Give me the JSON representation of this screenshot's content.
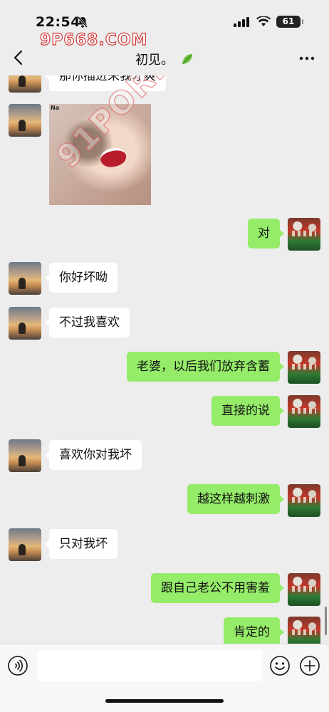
{
  "status_bar": {
    "time": "22:54",
    "battery": "61",
    "icons": [
      "bell-slash-icon",
      "signal-icon",
      "wifi-icon",
      "battery-icon"
    ]
  },
  "watermarks": {
    "top": "9P668.COM",
    "diagonal": "91PORN.COM"
  },
  "header": {
    "title": "初见。",
    "title_icon": "leaf-emoji",
    "back_icon": "chevron-left-icon",
    "more_icon": "more-dots-icon"
  },
  "sticker": {
    "tag": "Na"
  },
  "messages": [
    {
      "side": "left",
      "text": "那你插进来我才爽"
    },
    {
      "side": "left",
      "type": "sticker"
    },
    {
      "side": "right",
      "text": "对"
    },
    {
      "side": "left",
      "text": "你好坏呦"
    },
    {
      "side": "left",
      "text": "不过我喜欢"
    },
    {
      "side": "right",
      "text": "老婆，以后我们放弃含蓄"
    },
    {
      "side": "right",
      "text": "直接的说"
    },
    {
      "side": "left",
      "text": "喜欢你对我坏"
    },
    {
      "side": "right",
      "text": "越这样越刺激"
    },
    {
      "side": "left",
      "text": "只对我坏"
    },
    {
      "side": "right",
      "text": "跟自己老公不用害羞"
    },
    {
      "side": "right",
      "text": "肯定的"
    }
  ],
  "input_bar": {
    "value": "",
    "placeholder": "",
    "icons": [
      "voice-icon",
      "emoji-icon",
      "plus-icon"
    ]
  }
}
